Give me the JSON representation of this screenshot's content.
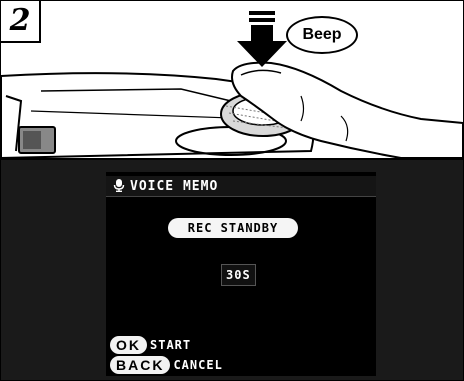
{
  "step": {
    "number": "2"
  },
  "illustration": {
    "beep_text": "Beep"
  },
  "screen": {
    "title": "VOICE MEMO",
    "title_icon": "microphone-icon",
    "status_pill": "REC STANDBY",
    "timer": "30S",
    "hints": [
      {
        "key": "OK",
        "action": "START"
      },
      {
        "key": "BACK",
        "action": "CANCEL"
      }
    ]
  },
  "colors": {
    "lcd_background": "#000000",
    "lcd_text": "#ffffff",
    "pill_background": "#f5f5f5"
  }
}
